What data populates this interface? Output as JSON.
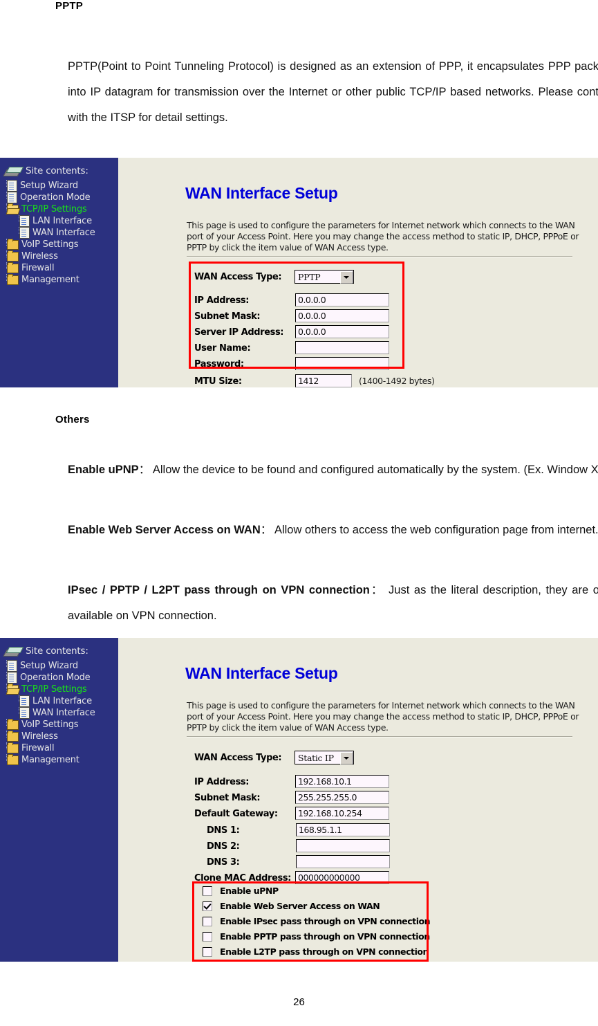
{
  "document": {
    "heading_pptp": "PPTP",
    "pptp_paragraph": "PPTP(Point to Point Tunneling Protocol) is designed as an extension of PPP, it encapsulates PPP packets into IP datagram for transmission over the Internet or other public TCP/IP based networks. Please contact with the ITSP for detail settings.",
    "heading_others": "Others",
    "others": [
      {
        "term": "Enable uPNP",
        "colon": "：",
        "desc": "Allow the device to be found and configured automatically by the system. (Ex. Window XP)"
      },
      {
        "term": "Enable Web Server Access on WAN",
        "colon": "：",
        "desc": "Allow others to access the web configuration page from internet."
      },
      {
        "term": "IPsec / PPTP / L2PT pass through on VPN connection",
        "colon": "：",
        "desc": "Just as the literal description, they are only available on VPN connection."
      }
    ],
    "page_number": "26"
  },
  "sidebar": {
    "title": "Site contents:",
    "items": [
      {
        "label": "Setup Wizard",
        "icon": "page-icon",
        "level": 0,
        "selected": false
      },
      {
        "label": "Operation Mode",
        "icon": "page-icon",
        "level": 0,
        "selected": false
      },
      {
        "label": "TCP/IP Settings",
        "icon": "folder-open-icon",
        "level": 0,
        "selected": true
      },
      {
        "label": "LAN Interface",
        "icon": "page-icon",
        "level": 1,
        "selected": false
      },
      {
        "label": "WAN Interface",
        "icon": "page-icon",
        "level": 1,
        "selected": false
      },
      {
        "label": "VoIP Settings",
        "icon": "folder-icon",
        "level": 0,
        "selected": false
      },
      {
        "label": "Wireless",
        "icon": "folder-icon",
        "level": 0,
        "selected": false
      },
      {
        "label": "Firewall",
        "icon": "folder-icon",
        "level": 0,
        "selected": false
      },
      {
        "label": "Management",
        "icon": "folder-icon",
        "level": 0,
        "selected": false
      }
    ]
  },
  "screenshot1": {
    "panel_title": "WAN Interface Setup",
    "panel_desc": "This page is used to configure the parameters for Internet network which connects to the WAN port of your Access Point. Here you may change the access method to static IP, DHCP, PPPoE or PPTP by click the item value of WAN Access type.",
    "access_type_label": "WAN Access Type:",
    "access_type_value": "PPTP",
    "fields": [
      {
        "label": "IP Address:",
        "value": "0.0.0.0"
      },
      {
        "label": "Subnet Mask:",
        "value": "0.0.0.0"
      },
      {
        "label": "Server IP Address:",
        "value": "0.0.0.0"
      },
      {
        "label": "User Name:",
        "value": ""
      },
      {
        "label": "Password:",
        "value": ""
      }
    ],
    "mtu_label": "MTU Size:",
    "mtu_value": "1412",
    "mtu_hint": "(1400-1492 bytes)"
  },
  "screenshot2": {
    "panel_title": "WAN Interface Setup",
    "panel_desc": "This page is used to configure the parameters for Internet network which connects to the WAN port of your Access Point. Here you may change the access method to static IP, DHCP, PPPoE or PPTP by click the item value of WAN Access type.",
    "access_type_label": "WAN Access Type:",
    "access_type_value": "Static IP",
    "fields": [
      {
        "label": "IP Address:",
        "value": "192.168.10.1",
        "indent": false
      },
      {
        "label": "Subnet Mask:",
        "value": "255.255.255.0",
        "indent": false
      },
      {
        "label": "Default Gateway:",
        "value": "192.168.10.254",
        "indent": false
      },
      {
        "label": "DNS 1:",
        "value": "168.95.1.1",
        "indent": true
      },
      {
        "label": "DNS 2:",
        "value": "",
        "indent": true
      },
      {
        "label": "DNS 3:",
        "value": "",
        "indent": true
      },
      {
        "label": "Clone MAC Address:",
        "value": "000000000000",
        "indent": false
      }
    ],
    "checkboxes": [
      {
        "label": "Enable uPNP",
        "checked": false
      },
      {
        "label": "Enable Web Server Access on WAN",
        "checked": true
      },
      {
        "label": "Enable IPsec pass through on VPN connection",
        "checked": false
      },
      {
        "label": "Enable PPTP pass through on VPN connection",
        "checked": false
      },
      {
        "label": "Enable L2TP pass through on VPN connection",
        "checked": false
      }
    ]
  },
  "colors": {
    "sidebar_bg": "#2b3180",
    "panel_bg": "#ebeade",
    "title_blue": "#0000d8",
    "selected_green": "#18e018",
    "highlight_red": "#ff0000"
  }
}
